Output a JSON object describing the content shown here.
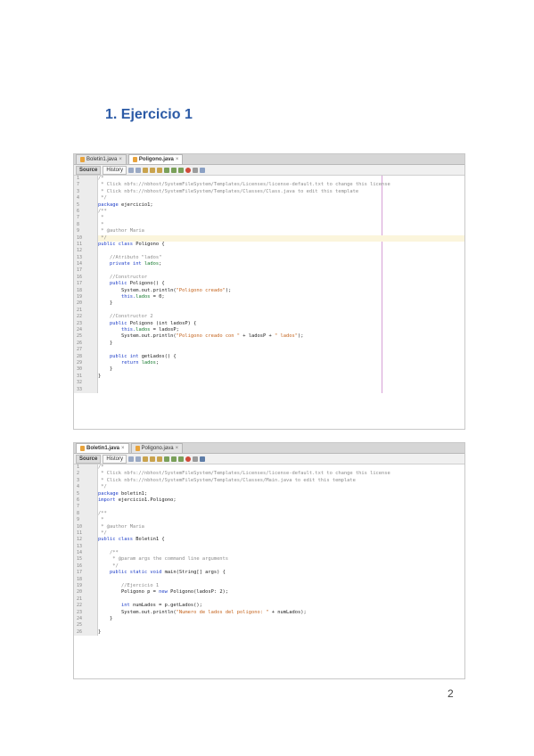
{
  "heading": "1. Ejercicio 1",
  "page_number": "2",
  "screenshot1": {
    "tabs": [
      {
        "label": "Boletin1.java",
        "active": false
      },
      {
        "label": "Poligono.java",
        "active": true
      }
    ],
    "toolbar": {
      "source": "Source",
      "history": "History"
    },
    "highlight_line": 9,
    "line_numbers": [
      "1",
      "7",
      "3",
      "4",
      "5",
      "6",
      "7",
      "8",
      "9",
      "10",
      "11",
      "12",
      "13",
      "14",
      "17",
      "16",
      "17",
      "18",
      "19",
      "20",
      "21",
      "22",
      "23",
      "24",
      "25",
      "26",
      "27",
      "28",
      "29",
      "30",
      "31",
      "32",
      "33"
    ],
    "lines": [
      [
        {
          "t": "/*",
          "c": "comment"
        }
      ],
      [
        {
          "t": " * Click nbfs://nbhost/SystemFileSystem/Templates/Licenses/license-default.txt to change this license",
          "c": "comment"
        }
      ],
      [
        {
          "t": " * Click nbfs://nbhost/SystemFileSystem/Templates/Classes/Class.java to edit this template",
          "c": "comment"
        }
      ],
      [
        {
          "t": " */",
          "c": "comment"
        }
      ],
      [
        {
          "t": "package ",
          "c": "kw"
        },
        {
          "t": "ejercicio1;",
          "c": "plain"
        }
      ],
      [
        {
          "t": "/**",
          "c": "comment"
        }
      ],
      [
        {
          "t": " *",
          "c": "comment"
        }
      ],
      [
        {
          "t": " *",
          "c": "comment"
        }
      ],
      [
        {
          "t": " * @author Maria",
          "c": "comment"
        }
      ],
      [
        {
          "t": " */",
          "c": "comment"
        }
      ],
      [
        {
          "t": "public class ",
          "c": "kw"
        },
        {
          "t": "Poligono {",
          "c": "plain"
        }
      ],
      [
        {
          "t": "",
          "c": "plain"
        }
      ],
      [
        {
          "t": "    //Atributo \"lados\"",
          "c": "comment"
        }
      ],
      [
        {
          "t": "    private int ",
          "c": "kw"
        },
        {
          "t": "lados",
          "c": "field"
        },
        {
          "t": ";",
          "c": "plain"
        }
      ],
      [
        {
          "t": "",
          "c": "plain"
        }
      ],
      [
        {
          "t": "    //Constructor",
          "c": "comment"
        }
      ],
      [
        {
          "t": "    public ",
          "c": "kw"
        },
        {
          "t": "Poligono() {",
          "c": "plain"
        }
      ],
      [
        {
          "t": "        System.out.println(",
          "c": "plain"
        },
        {
          "t": "\"Poligono creado\"",
          "c": "str"
        },
        {
          "t": ");",
          "c": "plain"
        }
      ],
      [
        {
          "t": "        this.",
          "c": "kw"
        },
        {
          "t": "lados",
          "c": "field"
        },
        {
          "t": " = 0;",
          "c": "plain"
        }
      ],
      [
        {
          "t": "    }",
          "c": "plain"
        }
      ],
      [
        {
          "t": "",
          "c": "plain"
        }
      ],
      [
        {
          "t": "    //Constructor 2",
          "c": "comment"
        }
      ],
      [
        {
          "t": "    public ",
          "c": "kw"
        },
        {
          "t": "Poligono (int ladosP) {",
          "c": "plain"
        }
      ],
      [
        {
          "t": "        this.",
          "c": "kw"
        },
        {
          "t": "lados",
          "c": "field"
        },
        {
          "t": " = ladosP;",
          "c": "plain"
        }
      ],
      [
        {
          "t": "        System.out.println(",
          "c": "plain"
        },
        {
          "t": "\"Poligono creado con \"",
          "c": "str"
        },
        {
          "t": " + ladosP + ",
          "c": "plain"
        },
        {
          "t": "\" lados\"",
          "c": "str"
        },
        {
          "t": ");",
          "c": "plain"
        }
      ],
      [
        {
          "t": "    }",
          "c": "plain"
        }
      ],
      [
        {
          "t": "",
          "c": "plain"
        }
      ],
      [
        {
          "t": "    public int ",
          "c": "kw"
        },
        {
          "t": "getLados() {",
          "c": "plain"
        }
      ],
      [
        {
          "t": "        return ",
          "c": "kw"
        },
        {
          "t": "lados",
          "c": "field"
        },
        {
          "t": ";",
          "c": "plain"
        }
      ],
      [
        {
          "t": "    }",
          "c": "plain"
        }
      ],
      [
        {
          "t": "}",
          "c": "plain"
        }
      ],
      [
        {
          "t": "",
          "c": "plain"
        }
      ],
      [
        {
          "t": "",
          "c": "plain"
        }
      ]
    ]
  },
  "screenshot2": {
    "tabs": [
      {
        "label": "Boletin1.java",
        "active": true
      },
      {
        "label": "Poligono.java",
        "active": false
      }
    ],
    "toolbar": {
      "source": "Source",
      "history": "History"
    },
    "line_numbers": [
      "1",
      "2",
      "3",
      "4",
      "5",
      "6",
      "7",
      "8",
      "9",
      "10",
      "11",
      "12",
      "13",
      "14",
      "15",
      "16",
      "17",
      "18",
      "19",
      "20",
      "21",
      "22",
      "23",
      "24",
      "25",
      "26"
    ],
    "lines": [
      [
        {
          "t": "/*",
          "c": "comment"
        }
      ],
      [
        {
          "t": " * Click nbfs://nbhost/SystemFileSystem/Templates/Licenses/license-default.txt to change this license",
          "c": "comment"
        }
      ],
      [
        {
          "t": " * Click nbfs://nbhost/SystemFileSystem/Templates/Classes/Main.java to edit this template",
          "c": "comment"
        }
      ],
      [
        {
          "t": " */",
          "c": "comment"
        }
      ],
      [
        {
          "t": "package ",
          "c": "kw"
        },
        {
          "t": "boletin1;",
          "c": "plain"
        }
      ],
      [
        {
          "t": "import ",
          "c": "kw"
        },
        {
          "t": "ejercicio1.Poligono;",
          "c": "plain"
        }
      ],
      [
        {
          "t": "",
          "c": "plain"
        }
      ],
      [
        {
          "t": "/**",
          "c": "comment"
        }
      ],
      [
        {
          "t": " *",
          "c": "comment"
        }
      ],
      [
        {
          "t": " * @author Maria",
          "c": "comment"
        }
      ],
      [
        {
          "t": " */",
          "c": "comment"
        }
      ],
      [
        {
          "t": "public class ",
          "c": "kw"
        },
        {
          "t": "Boletin1 {",
          "c": "plain"
        }
      ],
      [
        {
          "t": "",
          "c": "plain"
        }
      ],
      [
        {
          "t": "    /**",
          "c": "comment"
        }
      ],
      [
        {
          "t": "     * @param args the command line arguments",
          "c": "comment"
        }
      ],
      [
        {
          "t": "     */",
          "c": "comment"
        }
      ],
      [
        {
          "t": "    public static void ",
          "c": "kw"
        },
        {
          "t": "main(String[] args) {",
          "c": "plain"
        }
      ],
      [
        {
          "t": "",
          "c": "plain"
        }
      ],
      [
        {
          "t": "        //Ejercicio 1",
          "c": "comment"
        }
      ],
      [
        {
          "t": "        Poligono p = ",
          "c": "plain"
        },
        {
          "t": "new ",
          "c": "kw"
        },
        {
          "t": "Poligono(ladosP: 2);",
          "c": "plain"
        }
      ],
      [
        {
          "t": "",
          "c": "plain"
        }
      ],
      [
        {
          "t": "        int ",
          "c": "kw"
        },
        {
          "t": "numLados = p.getLados();",
          "c": "plain"
        }
      ],
      [
        {
          "t": "        System.out.println(",
          "c": "plain"
        },
        {
          "t": "\"Numero de lados del poligono: \"",
          "c": "str"
        },
        {
          "t": " + numLados);",
          "c": "plain"
        }
      ],
      [
        {
          "t": "    }",
          "c": "plain"
        }
      ],
      [
        {
          "t": "",
          "c": "plain"
        }
      ],
      [
        {
          "t": "}",
          "c": "plain"
        }
      ]
    ]
  }
}
